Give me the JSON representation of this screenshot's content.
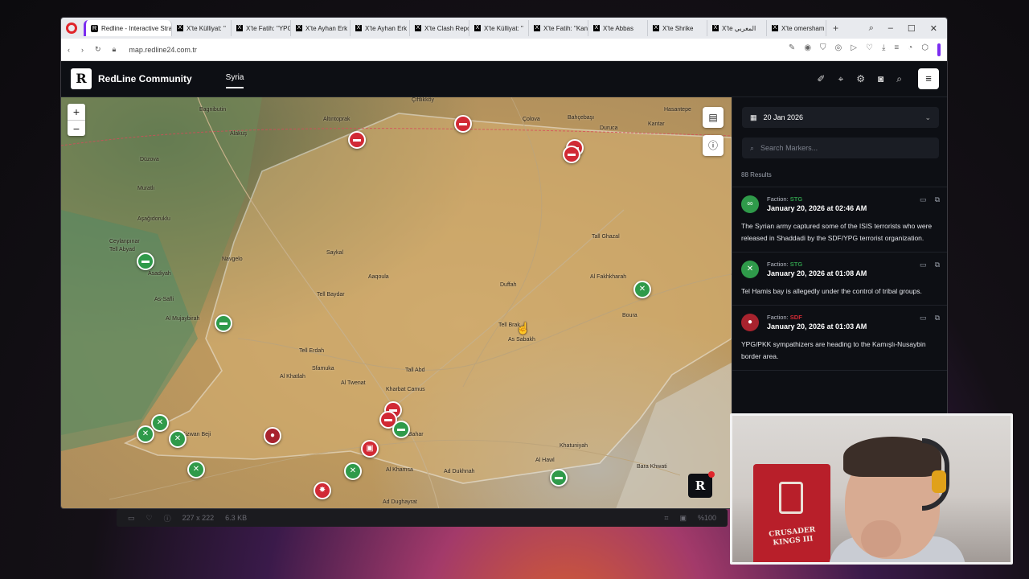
{
  "browser": {
    "tabs": [
      {
        "label": "Redline - Interactive Strat",
        "icon": "r-logo",
        "active": true
      },
      {
        "label": "X'te Külliyat: \"",
        "icon": "x-logo"
      },
      {
        "label": "X'te Fatih: \"YPG",
        "icon": "x-logo"
      },
      {
        "label": "X'te Ayhan Erk",
        "icon": "x-logo"
      },
      {
        "label": "X'te Ayhan Erk",
        "icon": "x-logo"
      },
      {
        "label": "X'te Clash Repo",
        "icon": "x-logo"
      },
      {
        "label": "X'te Külliyat: \"",
        "icon": "x-logo"
      },
      {
        "label": "X'te Fatih: \"Kan",
        "icon": "x-logo"
      },
      {
        "label": "X'te Abbas",
        "icon": "x-logo"
      },
      {
        "label": "X'te Shrike",
        "icon": "x-logo"
      },
      {
        "label": "X'te المغربي",
        "icon": "x-logo"
      },
      {
        "label": "X'te omersham",
        "icon": "x-logo"
      }
    ],
    "url": "map.redline24.com.tr"
  },
  "app": {
    "brand_letter": "R",
    "brand_name": "RedLine Community",
    "region_tab": "Syria"
  },
  "sidebar": {
    "date": "20 Jan 2026",
    "search_placeholder": "Search Markers...",
    "results": "88 Results",
    "events": [
      {
        "faction_label": "Faction:",
        "faction": "STG",
        "faction_color": "#2f9a4a",
        "time": "January 20, 2026 at 02:46 AM",
        "text": "The Syrian army captured some of the ISIS terrorists who were released in Shaddadi by the SDF/YPG terrorist organization.",
        "icon": "handcuffs-icon"
      },
      {
        "faction_label": "Faction:",
        "faction": "STG",
        "faction_color": "#2f9a4a",
        "time": "January 20, 2026 at 01:08 AM",
        "text": "Tel Hamis bay is allegedly under the control of tribal groups.",
        "icon": "rifles-icon"
      },
      {
        "faction_label": "Faction:",
        "faction": "SDF",
        "faction_color": "#d12a35",
        "time": "January 20, 2026 at 01:03 AM",
        "text": "YPG/PKK sympathizers are heading to the Kamışlı-Nusaybin border area.",
        "icon": "people-icon"
      }
    ]
  },
  "map": {
    "labels": [
      {
        "text": "Bagnibutin"
      },
      {
        "text": "Altıntoprak"
      },
      {
        "text": "Çiftlikköy"
      },
      {
        "text": "Çolova"
      },
      {
        "text": "Bahçebaşı"
      },
      {
        "text": "Duruca"
      },
      {
        "text": "Hasantepe"
      },
      {
        "text": "Kantar"
      },
      {
        "text": "Alakuş"
      },
      {
        "text": "Düzova"
      },
      {
        "text": "Muratlı"
      },
      {
        "text": "Aşağıdoruklu"
      },
      {
        "text": "Ceylanpınar"
      },
      {
        "text": "Tell Abyad"
      },
      {
        "text": "Asadiyah"
      },
      {
        "text": "As-Safli"
      },
      {
        "text": "Al Mujaybirah"
      },
      {
        "text": "Navgelo"
      },
      {
        "text": "Saykal"
      },
      {
        "text": "Aaqoula"
      },
      {
        "text": "Tell Baydar"
      },
      {
        "text": "Duffah"
      },
      {
        "text": "Tall Ghazal"
      },
      {
        "text": "Al Fakhkharah"
      },
      {
        "text": "Boura"
      },
      {
        "text": "Tell Brak"
      },
      {
        "text": "As Sabakh"
      },
      {
        "text": "Tell Erdah"
      },
      {
        "text": "Sfamuka"
      },
      {
        "text": "Al Khatlah"
      },
      {
        "text": "Al Twenat"
      },
      {
        "text": "Kharbat Camus"
      },
      {
        "text": "Tall Abd"
      },
      {
        "text": "Kizwan Beji"
      },
      {
        "text": "Ayn Bahar"
      },
      {
        "text": "Khatuniyah"
      },
      {
        "text": "Al Hawl"
      },
      {
        "text": "Bara Khwati"
      },
      {
        "text": "Al Khamsa"
      },
      {
        "text": "Ad Dukhnah"
      },
      {
        "text": "Ad Dughayrat"
      }
    ]
  },
  "bg_app_bar": {
    "dims": "227 x 222",
    "size": "6.3 KB",
    "zoom": "%100"
  },
  "webcam": {
    "sign_text": "CRUSADER KINGS III"
  },
  "colors": {
    "accent": "#7b2cf0",
    "stg_green": "#2f9a4a",
    "sdf_red": "#d12a35",
    "panel_bg": "#0d0f14"
  }
}
